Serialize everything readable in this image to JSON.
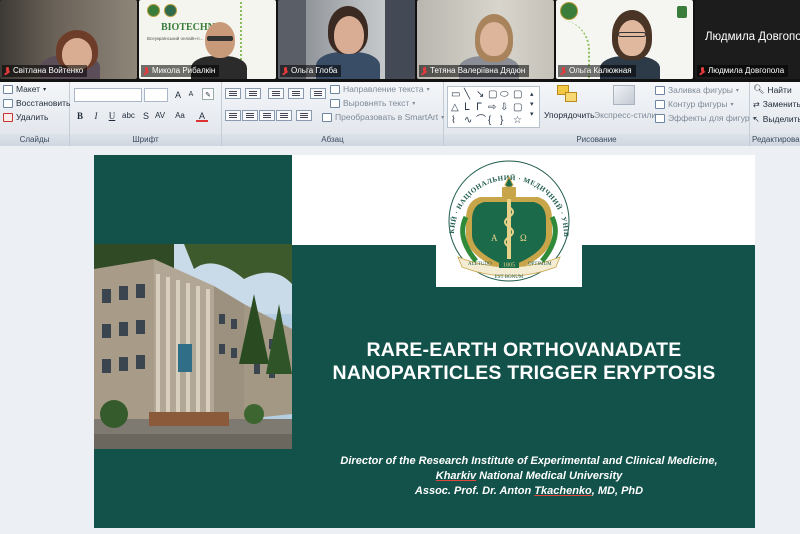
{
  "video_tiles": [
    {
      "name": "Світлана Войтенко",
      "muted": true
    },
    {
      "name": "Микола Рибалкін",
      "muted": true,
      "share_title": "BIOTECHN",
      "share_subtitle": "Всеукраїнський онлайн-п..."
    },
    {
      "name": "Ольга Глоба",
      "muted": true
    },
    {
      "name": "Тетяна Валеріївна Дядюн",
      "muted": true
    },
    {
      "name": "Ольга Калюжная",
      "muted": true
    },
    {
      "name": "Людмила Довгопола",
      "muted": true,
      "big_name": "Людмила Довгопола"
    }
  ],
  "ribbon": {
    "slides_group": {
      "label": "Слайды",
      "layout": "Макет",
      "reset": "Восстановить",
      "delete": "Удалить"
    },
    "font_group": {
      "label": "Шрифт"
    },
    "paragraph_group": {
      "label": "Абзац",
      "text_direction": "Направление текста",
      "align_text": "Выровнять текст",
      "convert_smartart": "Преобразовать в SmartArt"
    },
    "drawing_group": {
      "label": "Рисование",
      "arrange": "Упорядочить",
      "quick_styles": "Экспресс-стили",
      "shape_fill": "Заливка фигуры",
      "shape_outline": "Контур фигуры",
      "shape_effects": "Эффекты для фигур"
    },
    "editing_group": {
      "label": "Редактирован",
      "find": "Найти",
      "replace": "Заменить",
      "select": "Выделить"
    }
  },
  "slide": {
    "title_line1": "RARE-EARTH ORTHOVANADATE",
    "title_line2": "NANOPARTICLES TRIGGER ERYPTOSIS",
    "author_line1": "Director of the Research Institute of Experimental and Clinical Medicine,",
    "author_line2_u": "Kharkiv",
    "author_line2_rest": " National Medical University",
    "author_line3_a": "Assoc. Prof. Dr. Anton ",
    "author_line3_u": "Tkachenko",
    "author_line3_b": ", MD, PhD",
    "emblem": {
      "arc_text": "ХАРКІВСЬКИЙ · НАЦІОНАЛЬНИЙ · МЕДИЧНИЙ · УНІВЕРСИТЕТ",
      "alpha": "A",
      "omega": "Ω",
      "year": "1805",
      "motto_left": "ALETUDO",
      "motto_right": "OPTIMUM",
      "motto_bottom": "EST BONUM"
    }
  },
  "colors": {
    "slide_green": "#12524a",
    "ribbon_bg": "#dfe4ea",
    "muted_mic": "#e23b3b"
  }
}
